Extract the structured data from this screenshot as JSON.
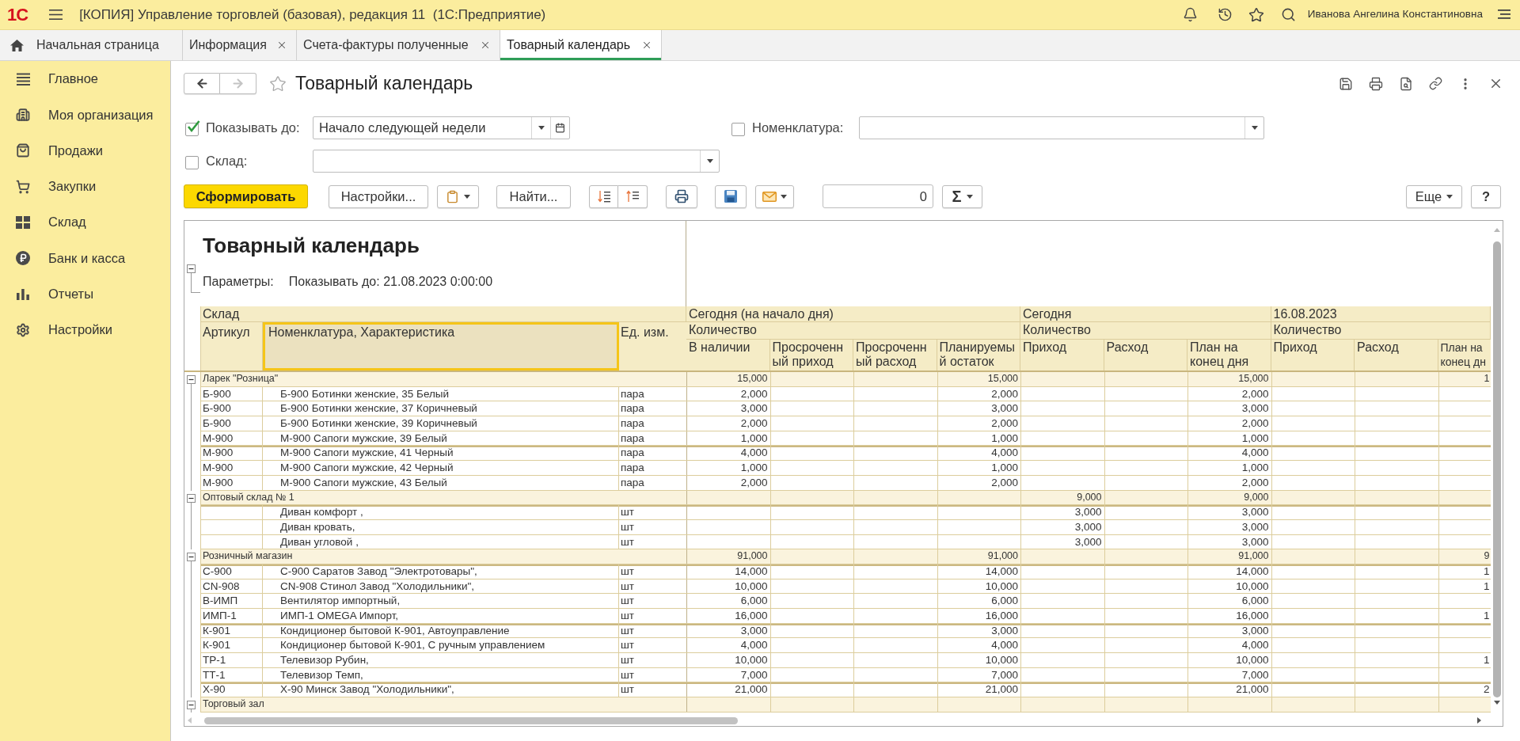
{
  "app_bar": {
    "logo": "1С",
    "title": "[КОПИЯ] Управление торговлей (базовая), редакция 11  (1С:Предприятие)",
    "user": "Иванова Ангелина Константиновна"
  },
  "tabs": [
    {
      "label": "Начальная страница",
      "kind": "home",
      "selected": false
    },
    {
      "label": "Информация",
      "kind": "document",
      "selected": false
    },
    {
      "label": "Счета-фактуры полученные",
      "kind": "document",
      "selected": false
    },
    {
      "label": "Товарный календарь",
      "kind": "document",
      "selected": true
    }
  ],
  "sidebar": {
    "items": [
      {
        "label": "Главное"
      },
      {
        "label": "Моя организация"
      },
      {
        "label": "Продажи"
      },
      {
        "label": "Закупки"
      },
      {
        "label": "Склад"
      },
      {
        "label": "Банк и касса"
      },
      {
        "label": "Отчеты"
      },
      {
        "label": "Настройки"
      }
    ]
  },
  "form": {
    "title": "Товарный календарь",
    "favorite": false,
    "back_disabled": false,
    "forward_disabled": true
  },
  "filters": [
    {
      "label": "Показывать до:",
      "checked": true,
      "kind": "period",
      "value": "Начало следующей недели"
    },
    {
      "label": "Номенклатура:",
      "checked": false,
      "kind": "select"
    },
    {
      "label": "Склад:",
      "checked": false,
      "kind": "select"
    }
  ],
  "toolbar": {
    "generate": "Сформировать",
    "settings": "Настройки...",
    "find": "Найти...",
    "counter": "0",
    "sum": "Σ",
    "more": "Еще",
    "help": "?"
  },
  "report": {
    "title": "Товарный календарь",
    "expanded": true,
    "parameters_label": "Параметры:",
    "parameters_value": "Показывать до: 21.08.2023 0:00:00",
    "header": {
      "group_label": "Склад",
      "columns": [
        {
          "label": "Артикул",
          "selected": false
        },
        {
          "label": "Номенклатура, Характеристика",
          "selected": true
        },
        {
          "label": "Ед. изм.",
          "selected": false
        }
      ],
      "periods": [
        {
          "label": "Сегодня (на начало дня)",
          "measure": "Количество",
          "columns": [
            "В наличии",
            "Просроченный приход",
            "Просроченный расход",
            "Планируемый остаток"
          ]
        },
        {
          "label": "Сегодня",
          "measure": "Количество",
          "columns": [
            "Приход",
            "Расход",
            "План на конец дня"
          ]
        },
        {
          "label": "16.08.2023",
          "measure": "Количество",
          "columns": [
            "Приход",
            "Расход",
            "План на конец дн"
          ]
        }
      ]
    },
    "groups": [
      {
        "name": "Ларек \"Розница\"",
        "expanded": true,
        "values": {
          "in_stock": "15,000",
          "planned_balance": "15,000",
          "today_plan_end": "15,000",
          "date_plan_end": "1"
        },
        "children": [
          {
            "article": "Б-900",
            "name": "Б-900 Ботинки женские, 35 Белый",
            "unit": "пара",
            "values": {
              "in_stock": "2,000",
              "planned_balance": "2,000",
              "today_plan_end": "2,000"
            }
          },
          {
            "article": "Б-900",
            "name": "Б-900 Ботинки женские, 37 Коричневый",
            "unit": "пара",
            "values": {
              "in_stock": "3,000",
              "planned_balance": "3,000",
              "today_plan_end": "3,000"
            }
          },
          {
            "article": "Б-900",
            "name": "Б-900 Ботинки женские, 39 Коричневый",
            "unit": "пара",
            "values": {
              "in_stock": "2,000",
              "planned_balance": "2,000",
              "today_plan_end": "2,000"
            }
          },
          {
            "article": "М-900",
            "name": "М-900 Сапоги мужские, 39 Белый",
            "unit": "пара",
            "values": {
              "in_stock": "1,000",
              "planned_balance": "1,000",
              "today_plan_end": "1,000"
            }
          },
          {
            "article": "М-900",
            "name": "М-900 Сапоги мужские, 41 Черный",
            "unit": "пара",
            "values": {
              "in_stock": "4,000",
              "planned_balance": "4,000",
              "today_plan_end": "4,000"
            }
          },
          {
            "article": "М-900",
            "name": "М-900 Сапоги мужские, 42 Черный",
            "unit": "пара",
            "values": {
              "in_stock": "1,000",
              "planned_balance": "1,000",
              "today_plan_end": "1,000"
            }
          },
          {
            "article": "М-900",
            "name": "М-900 Сапоги мужские, 43 Белый",
            "unit": "пара",
            "values": {
              "in_stock": "2,000",
              "planned_balance": "2,000",
              "today_plan_end": "2,000"
            }
          }
        ]
      },
      {
        "name": "Оптовый склад № 1",
        "expanded": true,
        "values": {
          "today_receipt": "9,000",
          "today_plan_end": "9,000"
        },
        "children": [
          {
            "name": "Диван комфорт ,",
            "unit": "шт",
            "values": {
              "today_receipt": "3,000",
              "today_plan_end": "3,000"
            }
          },
          {
            "name": "Диван кровать,",
            "unit": "шт",
            "values": {
              "today_receipt": "3,000",
              "today_plan_end": "3,000"
            }
          },
          {
            "name": "Диван угловой ,",
            "unit": "шт",
            "values": {
              "today_receipt": "3,000",
              "today_plan_end": "3,000"
            }
          }
        ]
      },
      {
        "name": "Розничный магазин",
        "expanded": true,
        "values": {
          "in_stock": "91,000",
          "planned_balance": "91,000",
          "today_plan_end": "91,000",
          "date_plan_end": "9"
        },
        "children": [
          {
            "article": "С-900",
            "name": "С-900 Саратов Завод \"Электротовары\",",
            "unit": "шт",
            "values": {
              "in_stock": "14,000",
              "planned_balance": "14,000",
              "today_plan_end": "14,000",
              "date_plan_end": "1"
            }
          },
          {
            "article": "CN-908",
            "name": "CN-908 Стинол Завод \"Холодильники\",",
            "unit": "шт",
            "values": {
              "in_stock": "10,000",
              "planned_balance": "10,000",
              "today_plan_end": "10,000",
              "date_plan_end": "1"
            }
          },
          {
            "article": "В-ИМП",
            "name": "Вентилятор импортный,",
            "unit": "шт",
            "values": {
              "in_stock": "6,000",
              "planned_balance": "6,000",
              "today_plan_end": "6,000"
            }
          },
          {
            "article": "ИМП-1",
            "name": "ИМП-1 OMEGA Импорт,",
            "unit": "шт",
            "values": {
              "in_stock": "16,000",
              "planned_balance": "16,000",
              "today_plan_end": "16,000",
              "date_plan_end": "1"
            }
          },
          {
            "article": "К-901",
            "name": "Кондиционер бытовой К-901, Автоуправление",
            "unit": "шт",
            "values": {
              "in_stock": "3,000",
              "planned_balance": "3,000",
              "today_plan_end": "3,000"
            }
          },
          {
            "article": "К-901",
            "name": "Кондиционер бытовой К-901, С ручным управлением",
            "unit": "шт",
            "values": {
              "in_stock": "4,000",
              "planned_balance": "4,000",
              "today_plan_end": "4,000"
            }
          },
          {
            "article": "ТР-1",
            "name": "Телевизор Рубин,",
            "unit": "шт",
            "values": {
              "in_stock": "10,000",
              "planned_balance": "10,000",
              "today_plan_end": "10,000",
              "date_plan_end": "1"
            }
          },
          {
            "article": "ТТ-1",
            "name": "Телевизор Темп,",
            "unit": "шт",
            "values": {
              "in_stock": "7,000",
              "planned_balance": "7,000",
              "today_plan_end": "7,000"
            }
          },
          {
            "article": "Х-90",
            "name": "Х-90 Минск Завод \"Холодильники\",",
            "unit": "шт",
            "values": {
              "in_stock": "21,000",
              "planned_balance": "21,000",
              "today_plan_end": "21,000",
              "date_plan_end": "2"
            }
          }
        ]
      },
      {
        "name": "Торговый зал",
        "expanded": true
      }
    ]
  }
}
